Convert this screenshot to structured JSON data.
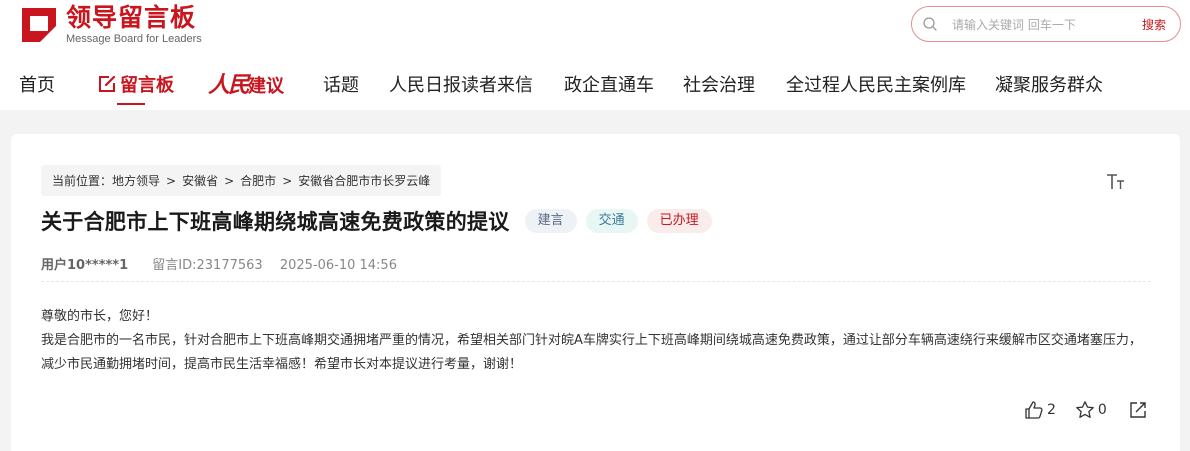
{
  "logo": {
    "title": "领导留言板",
    "subtitle": "Message Board for Leaders"
  },
  "search": {
    "placeholder": "请输入关键词 回车一下",
    "button_label": "搜索"
  },
  "nav": {
    "home": "首页",
    "board": "留言板",
    "renmin_script": "人民",
    "renmin_suffix": "建议",
    "topics": "话题",
    "readers": "人民日报读者来信",
    "enterprise": "政企直通车",
    "governance": "社会治理",
    "democracy": "全过程人民民主案例库",
    "service": "凝聚服务群众"
  },
  "breadcrumb": {
    "prefix": "当前位置：",
    "items": [
      "地方领导",
      "安徽省",
      "合肥市",
      "安徽省合肥市市长罗云峰"
    ],
    "separator": ">"
  },
  "post": {
    "title": "关于合肥市上下班高峰期绕城高速免费政策的提议",
    "tags": [
      {
        "label": "建言",
        "bg": "#eef1f6",
        "color": "#5a6a85"
      },
      {
        "label": "交通",
        "bg": "#e8f6f4",
        "color": "#3a7b9c"
      },
      {
        "label": "已办理",
        "bg": "#fbecec",
        "color": "#c9151e"
      }
    ],
    "user": "用户10*****1",
    "message_id": "留言ID:23177563",
    "time": "2025-06-10 14:56",
    "greeting": "尊敬的市长，您好！",
    "body": "我是合肥市的一名市民，针对合肥市上下班高峰期交通拥堵严重的情况，希望相关部门针对皖A车牌实行上下班高峰期间绕城高速免费政策，通过让部分车辆高速绕行来缓解市区交通堵塞压力，减少市民通勤拥堵时间，提高市民生活幸福感！希望市长对本提议进行考量，谢谢！"
  },
  "actions": {
    "likes": "2",
    "favorites": "0"
  },
  "icons": {
    "logo": "board-logo-icon",
    "search": "search-icon",
    "edit": "edit-icon",
    "font_size": "font-size-icon",
    "like": "thumbs-up-icon",
    "favorite": "star-icon",
    "share": "share-icon"
  },
  "colors": {
    "brand": "#c9151e",
    "gray_bg": "#f3f3f3"
  }
}
